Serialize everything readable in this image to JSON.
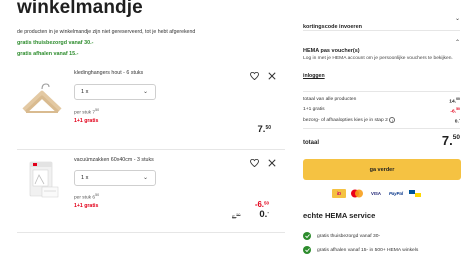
{
  "page": {
    "title": "winkelmandje",
    "intro": "de producten in je winkelmandje zijn niet gereserveerd, tot je hebt afgerekend",
    "promos": [
      "gratis thuisbezorgd vanaf 30.-",
      "gratis afhalen vanaf 15.-"
    ]
  },
  "items": [
    {
      "name": "kledinghangers hout - 6 stuks",
      "qty": "1 x",
      "per_piece_label": "per stuk 7",
      "per_piece_cents": "50",
      "deal": "1+1 gratis",
      "price_main": "7.",
      "price_cents": "50"
    },
    {
      "name": "vacuümzakken 60x40cm - 3 stuks",
      "qty": "1 x",
      "per_piece_label": "per stuk 6",
      "per_piece_cents": "50",
      "deal": "1+1 gratis",
      "discount_main": "-6.",
      "discount_cents": "50",
      "old_price_main": "6.",
      "old_price_cents": "50",
      "price_main": "0."
    }
  ],
  "sidebar": {
    "coupon_label": "kortingscode invoeren",
    "voucher_label": "HEMA pas voucher(s)",
    "login_text": "Log in met je HEMA account om je persoonlijke vouchers te bekijken.",
    "login_link": "inloggen",
    "summary": {
      "rows": [
        {
          "label": "totaal van alle producten",
          "value": "14.",
          "cents": "00",
          "red": false
        },
        {
          "label": "1+1 gratis",
          "value": "-6.",
          "cents": "50",
          "red": true
        },
        {
          "label": "bezorg- of afhaalopties kies je in stap 2",
          "value": "0.",
          "cents": "-",
          "red": false
        }
      ],
      "total_label": "totaal",
      "total_main": "7.",
      "total_cents": "50"
    },
    "checkout_button": "ga verder",
    "payment_methods": [
      "iDEAL",
      "Mastercard",
      "VISA",
      "PayPal",
      "Bancontact"
    ],
    "service_title": "echte HEMA service",
    "service_items": [
      "gratis thuisbezorgd vanaf 30-",
      "gratis afhalen vanaf 15- in 500+ HEMA winkels"
    ]
  },
  "colors": {
    "accent_yellow": "#f5c242",
    "promo_green": "#2d8c2d",
    "deal_red": "#e2001a"
  }
}
